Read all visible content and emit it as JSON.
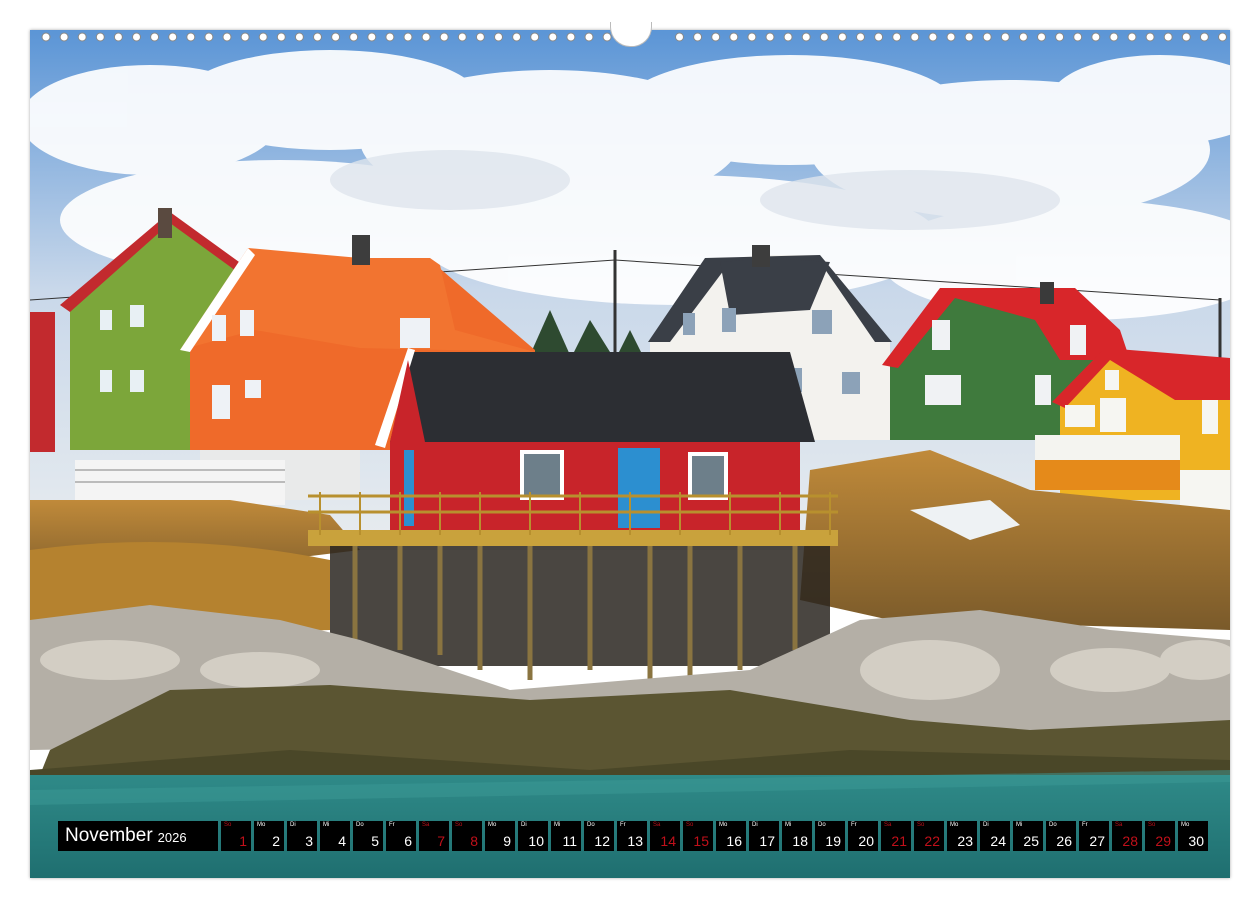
{
  "calendar": {
    "month": "November",
    "year": "2026",
    "days": [
      {
        "wd": "So",
        "num": "1",
        "weekend": true
      },
      {
        "wd": "Mo",
        "num": "2",
        "weekend": false
      },
      {
        "wd": "Di",
        "num": "3",
        "weekend": false
      },
      {
        "wd": "Mi",
        "num": "4",
        "weekend": false
      },
      {
        "wd": "Do",
        "num": "5",
        "weekend": false
      },
      {
        "wd": "Fr",
        "num": "6",
        "weekend": false
      },
      {
        "wd": "Sa",
        "num": "7",
        "weekend": true
      },
      {
        "wd": "So",
        "num": "8",
        "weekend": true
      },
      {
        "wd": "Mo",
        "num": "9",
        "weekend": false
      },
      {
        "wd": "Di",
        "num": "10",
        "weekend": false
      },
      {
        "wd": "Mi",
        "num": "11",
        "weekend": false
      },
      {
        "wd": "Do",
        "num": "12",
        "weekend": false
      },
      {
        "wd": "Fr",
        "num": "13",
        "weekend": false
      },
      {
        "wd": "Sa",
        "num": "14",
        "weekend": true
      },
      {
        "wd": "So",
        "num": "15",
        "weekend": true
      },
      {
        "wd": "Mo",
        "num": "16",
        "weekend": false
      },
      {
        "wd": "Di",
        "num": "17",
        "weekend": false
      },
      {
        "wd": "Mi",
        "num": "18",
        "weekend": false
      },
      {
        "wd": "Do",
        "num": "19",
        "weekend": false
      },
      {
        "wd": "Fr",
        "num": "20",
        "weekend": false
      },
      {
        "wd": "Sa",
        "num": "21",
        "weekend": true
      },
      {
        "wd": "So",
        "num": "22",
        "weekend": true
      },
      {
        "wd": "Mo",
        "num": "23",
        "weekend": false
      },
      {
        "wd": "Di",
        "num": "24",
        "weekend": false
      },
      {
        "wd": "Mi",
        "num": "25",
        "weekend": false
      },
      {
        "wd": "Do",
        "num": "26",
        "weekend": false
      },
      {
        "wd": "Fr",
        "num": "27",
        "weekend": false
      },
      {
        "wd": "Sa",
        "num": "28",
        "weekend": true
      },
      {
        "wd": "So",
        "num": "29",
        "weekend": true
      },
      {
        "wd": "Mo",
        "num": "30",
        "weekend": false
      }
    ]
  },
  "colors": {
    "cell_background": "#000000",
    "weekend_text": "#c1101a",
    "weekday_text": "#ffffff"
  }
}
